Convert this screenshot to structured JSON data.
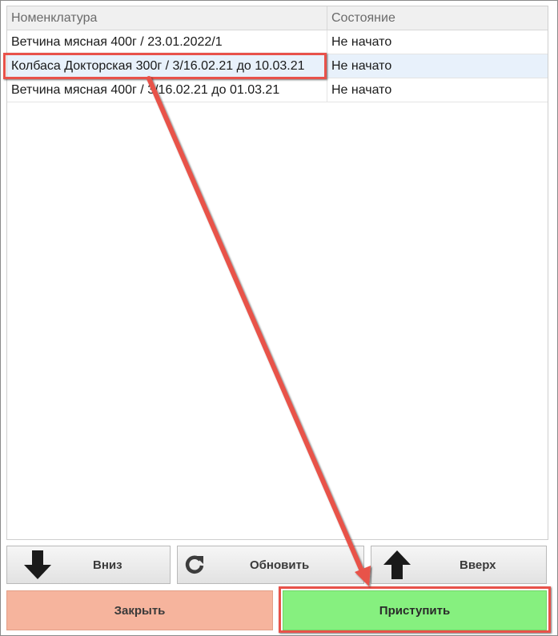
{
  "grid": {
    "columns": [
      "Номенклатура",
      "Состояние"
    ],
    "rows": [
      {
        "name": "Ветчина мясная 400г / 23.01.2022/1",
        "status": "Не начато"
      },
      {
        "name": "Колбаса Докторская 300г / 3/16.02.21 до 10.03.21",
        "status": "Не начато"
      },
      {
        "name": "Ветчина мясная 400г / 3/16.02.21 до 01.03.21",
        "status": "Не начато"
      }
    ],
    "selected_row": 1
  },
  "toolbar": {
    "down_label": "Вниз",
    "refresh_label": "Обновить",
    "up_label": "Вверх"
  },
  "actions": {
    "close_label": "Закрыть",
    "start_label": "Приступить"
  },
  "colors": {
    "annotation": "#e8524a",
    "close_button": "#f6b49d",
    "start_button": "#86f07f",
    "selected_row": "#e8f1fb"
  },
  "icons": {
    "down": "arrow-down-icon",
    "refresh": "refresh-icon",
    "up": "arrow-up-icon"
  }
}
